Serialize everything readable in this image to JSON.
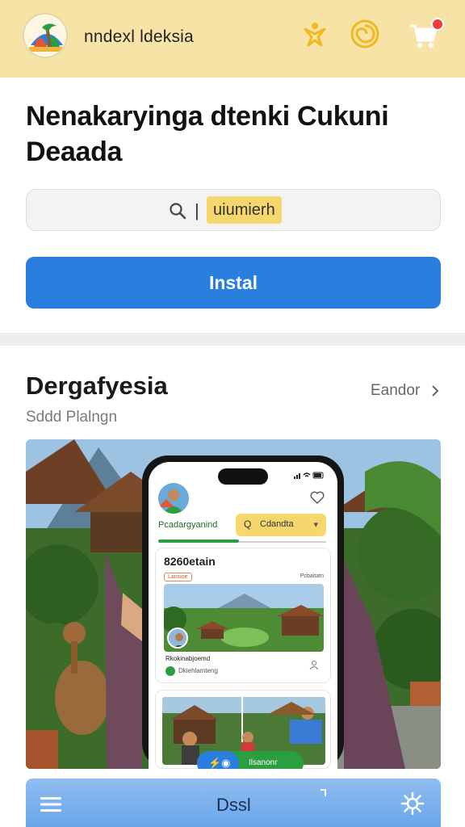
{
  "header": {
    "app_name": "nndexl ldeksia",
    "icon_a": "star-person-icon",
    "icon_b": "swirl-icon",
    "icon_c": "cart-icon",
    "cart_badge_color": "#ee3b3b"
  },
  "main": {
    "title": "Nenakaryinga dtenki Cukuni Deaada",
    "search_value": "uiumierh",
    "install_label": "Instal"
  },
  "section": {
    "title": "Dergafyesia",
    "see_all_label": "Eandor",
    "subtitle": "Sddd Plalngn"
  },
  "phone": {
    "brand": "Pcadargyanind",
    "search_text": "Cdandta",
    "card1_title": "8260etain",
    "card1_tag": "Lansioe",
    "card1_right": "Pcbaitatn",
    "card1_caption": "Rkokinabjoemd",
    "card1_caption2": "Dkiehlamteng",
    "pill_label": "Ilsanonr"
  },
  "bottom_nav": {
    "label": "Dssl"
  },
  "colors": {
    "header_bg": "#f7e3a6",
    "accent_blue": "#2a7fde",
    "accent_green": "#2b9e3f",
    "highlight_yellow": "#f5d76e"
  }
}
